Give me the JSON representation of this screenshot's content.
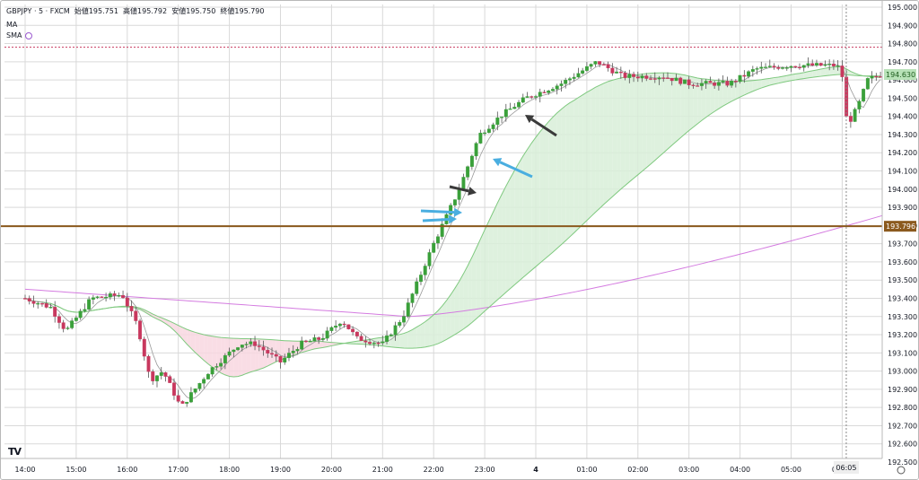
{
  "header": {
    "symbol_line": "GBPJPY · 5 · FXCM",
    "open_label": "始値",
    "open_value": "195.751",
    "high_label": "高値",
    "high_value": "195.792",
    "low_label": "安値",
    "low_value": "195.750",
    "close_label": "終値",
    "close_value": "195.790",
    "ma_label": "MA",
    "sma_label": "SMA"
  },
  "logo_text": "TV",
  "colors": {
    "up": "#3aa03a",
    "down": "#c8385e",
    "grid": "#d9d9d9",
    "horizontal_line": "#8b5a1e",
    "ma_fast": "#c0c0c0",
    "ma_mid": "#7fc97f",
    "sma_long": "#d47be0",
    "fill_green": "#d8efd8",
    "fill_pink": "#f8d7e0",
    "arrow_blue": "#4aaee0",
    "arrow_dark": "#3a3a3a",
    "price_badge": "#b8e2b8",
    "level_badge": "#8b5a1e"
  },
  "chart_data": {
    "type": "candlestick",
    "symbol": "GBPJPY",
    "timeframe": "5",
    "source": "FXCM",
    "y_ticks": [
      "195.000",
      "194.900",
      "194.800",
      "194.700",
      "194.600",
      "194.500",
      "194.400",
      "194.300",
      "194.200",
      "194.100",
      "194.000",
      "193.900",
      "193.800",
      "193.700",
      "193.600",
      "193.500",
      "193.400",
      "193.300",
      "193.200",
      "193.100",
      "193.000",
      "192.900",
      "192.800",
      "192.700",
      "192.600",
      "192.500"
    ],
    "x_ticks": [
      "14:00",
      "15:00",
      "16:00",
      "17:00",
      "18:00",
      "19:00",
      "20:00",
      "21:00",
      "22:00",
      "23:00",
      "4",
      "01:00",
      "02:00",
      "03:00",
      "04:00",
      "05:00",
      "06:00"
    ],
    "ylim": [
      192.5,
      195.0
    ],
    "current_price": "194.630",
    "horizontal_level": "193.796",
    "crosshair_time": "06:05",
    "reference_level": 194.78,
    "price_path": [
      [
        0,
        193.4
      ],
      [
        0.5,
        193.35
      ],
      [
        0.8,
        193.22
      ],
      [
        1.3,
        193.4
      ],
      [
        1.9,
        193.42
      ],
      [
        2.2,
        193.25
      ],
      [
        2.45,
        192.95
      ],
      [
        2.7,
        193.0
      ],
      [
        3.05,
        192.8
      ],
      [
        3.6,
        193.0
      ],
      [
        4.2,
        193.15
      ],
      [
        4.5,
        193.15
      ],
      [
        5.0,
        193.05
      ],
      [
        5.4,
        193.15
      ],
      [
        5.8,
        193.18
      ],
      [
        6.2,
        193.28
      ],
      [
        6.5,
        193.18
      ],
      [
        7.0,
        193.15
      ],
      [
        7.4,
        193.3
      ],
      [
        8.0,
        193.7
      ],
      [
        8.5,
        194.0
      ],
      [
        8.9,
        194.3
      ],
      [
        9.3,
        194.4
      ],
      [
        9.8,
        194.5
      ],
      [
        10.5,
        194.58
      ],
      [
        11.2,
        194.7
      ],
      [
        11.7,
        194.62
      ],
      [
        12.5,
        194.62
      ],
      [
        13.0,
        194.58
      ],
      [
        13.8,
        194.58
      ],
      [
        14.3,
        194.66
      ],
      [
        15.0,
        194.68
      ],
      [
        15.9,
        194.68
      ],
      [
        16.0,
        194.62
      ],
      [
        16.1,
        194.35
      ],
      [
        16.3,
        194.45
      ],
      [
        16.5,
        194.6
      ],
      [
        16.75,
        194.63
      ]
    ]
  }
}
